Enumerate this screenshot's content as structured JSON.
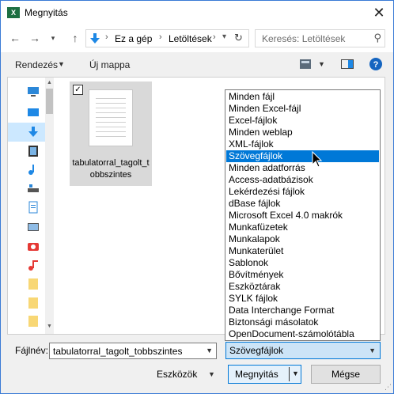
{
  "window": {
    "title": "Megnyitás",
    "app_icon_text": "X"
  },
  "address": {
    "crumbs": [
      "Ez a gép",
      "Letöltések"
    ]
  },
  "search": {
    "placeholder": "Keresés: Letöltések"
  },
  "toolbar": {
    "organize_label": "Rendezés",
    "new_folder_label": "Új mappa"
  },
  "file": {
    "name": "tabulatorral_tagolt_tobbszintes"
  },
  "file_type_options": [
    "Minden fájl",
    "Minden Excel-fájl",
    "Excel-fájlok",
    "Minden weblap",
    "XML-fájlok",
    "Szövegfájlok",
    "Minden adatforrás",
    "Access-adatbázisok",
    "Lekérdezési fájlok",
    "dBase fájlok",
    "Microsoft Excel 4.0 makrók",
    "Munkafüzetek",
    "Munkalapok",
    "Munkaterület",
    "Sablonok",
    "Bővítmények",
    "Eszköztárak",
    "SYLK fájlok",
    "Data Interchange Format",
    "Biztonsági másolatok",
    "OpenDocument-számolótábla"
  ],
  "selected_option": "Szövegfájlok",
  "bottom": {
    "filename_label": "Fájlnév:",
    "filename_value": "tabulatorral_tagolt_tobbszintes",
    "type_value": "Szövegfájlok",
    "tools_label": "Eszközök",
    "open_label": "Megnyitás",
    "cancel_label": "Mégse"
  },
  "colors": {
    "accent": "#0078d7",
    "selection": "#cce8ff",
    "excel_green": "#1d6f42"
  }
}
